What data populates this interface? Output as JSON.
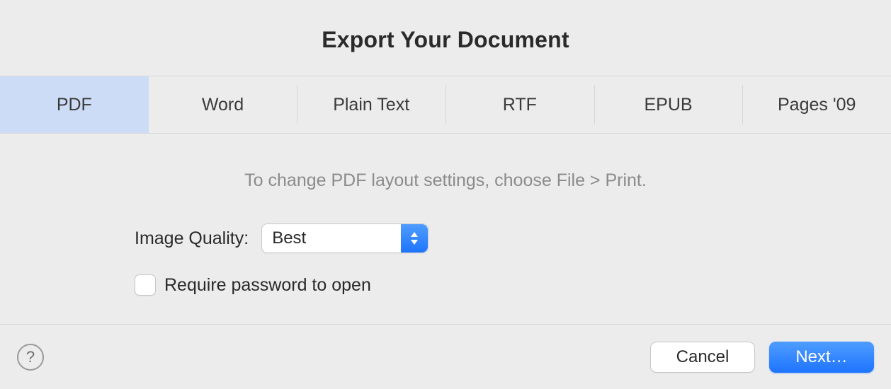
{
  "title": "Export Your Document",
  "tabs": [
    {
      "label": "PDF",
      "selected": true
    },
    {
      "label": "Word",
      "selected": false
    },
    {
      "label": "Plain Text",
      "selected": false
    },
    {
      "label": "RTF",
      "selected": false
    },
    {
      "label": "EPUB",
      "selected": false
    },
    {
      "label": "Pages '09",
      "selected": false
    }
  ],
  "hint": "To change PDF layout settings, choose File > Print.",
  "imageQuality": {
    "label": "Image Quality:",
    "value": "Best"
  },
  "requirePassword": {
    "label": "Require password to open",
    "checked": false
  },
  "help": "?",
  "buttons": {
    "cancel": "Cancel",
    "next": "Next…"
  }
}
